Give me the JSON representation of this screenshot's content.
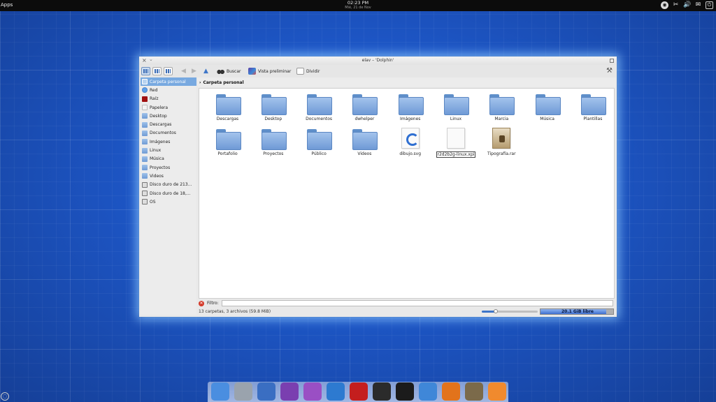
{
  "top_panel": {
    "apps_label": "Apps",
    "time": "02:23 PM",
    "date": "Mié, 21 de Nov"
  },
  "window": {
    "title": "elav – 'Dolphin'",
    "toolbar": {
      "search_label": "Buscar",
      "preview_label": "Vista preliminar",
      "split_label": "Dividir"
    },
    "sidebar": {
      "items": [
        {
          "label": "Carpeta personal",
          "icon": "home-folder-icon",
          "selected": true
        },
        {
          "label": "Red",
          "icon": "network-icon"
        },
        {
          "label": "Raíz",
          "icon": "root-folder-icon"
        },
        {
          "label": "Papelera",
          "icon": "trash-icon"
        },
        {
          "label": "Desktop",
          "icon": "folder-icon"
        },
        {
          "label": "Descargas",
          "icon": "folder-icon"
        },
        {
          "label": "Documentos",
          "icon": "folder-icon"
        },
        {
          "label": "Imágenes",
          "icon": "folder-icon"
        },
        {
          "label": "Linux",
          "icon": "folder-icon"
        },
        {
          "label": "Música",
          "icon": "folder-icon"
        },
        {
          "label": "Proyectos",
          "icon": "folder-icon"
        },
        {
          "label": "Videos",
          "icon": "folder-icon"
        },
        {
          "label": "Disco duro de 213...",
          "icon": "hard-disk-icon"
        },
        {
          "label": "Disco duro de 18,...",
          "icon": "hard-disk-icon"
        },
        {
          "label": "OS",
          "icon": "hard-disk-icon"
        }
      ]
    },
    "breadcrumb": "Carpeta personal",
    "files": [
      {
        "name": "Descargas",
        "type": "folder"
      },
      {
        "name": "Desktop",
        "type": "folder"
      },
      {
        "name": "Documentos",
        "type": "folder"
      },
      {
        "name": "dwhelper",
        "type": "folder"
      },
      {
        "name": "Imágenes",
        "type": "folder"
      },
      {
        "name": "Linux",
        "type": "folder"
      },
      {
        "name": "Marcia",
        "type": "folder"
      },
      {
        "name": "Música",
        "type": "folder"
      },
      {
        "name": "Plantillas",
        "type": "folder"
      },
      {
        "name": "Portafolio",
        "type": "folder"
      },
      {
        "name": "Proyectos",
        "type": "folder"
      },
      {
        "name": "Público",
        "type": "folder"
      },
      {
        "name": "Videos",
        "type": "folder"
      },
      {
        "name": "dibujo.svg",
        "type": "svg"
      },
      {
        "name": "r2d2b2g-linux.xpi",
        "type": "file",
        "renaming": true
      },
      {
        "name": "Tipografía.rar",
        "type": "rar"
      }
    ],
    "filter_label": "Filtro:",
    "filter_value": "",
    "status_text": "13 carpetas, 3 archivos (59.8 MiB)",
    "zoom_fraction": 0.25,
    "free_space_text": "20.1 GiB libre",
    "used_space_fraction": 0.9
  },
  "dock": {
    "items": [
      {
        "name": "file-manager-icon",
        "color": "#4a8ee0"
      },
      {
        "name": "archive-icon",
        "color": "#9aa3ad"
      },
      {
        "name": "system-tools-icon",
        "color": "#3a6ec2"
      },
      {
        "name": "desktop-effects-icon",
        "color": "#7a3fb0"
      },
      {
        "name": "eye-icon",
        "color": "#9a4fc4"
      },
      {
        "name": "browser-icon",
        "color": "#2d7ad0"
      },
      {
        "name": "filezilla-icon",
        "color": "#c41e1e"
      },
      {
        "name": "terminal-icon",
        "color": "#2b2b2b"
      },
      {
        "name": "inkscape-icon",
        "color": "#1b1b1b"
      },
      {
        "name": "editor-icon",
        "color": "#3f87d8"
      },
      {
        "name": "firefox-icon",
        "color": "#e2731b"
      },
      {
        "name": "gimp-icon",
        "color": "#7b6a4a"
      },
      {
        "name": "media-player-icon",
        "color": "#f08a2e"
      }
    ]
  }
}
